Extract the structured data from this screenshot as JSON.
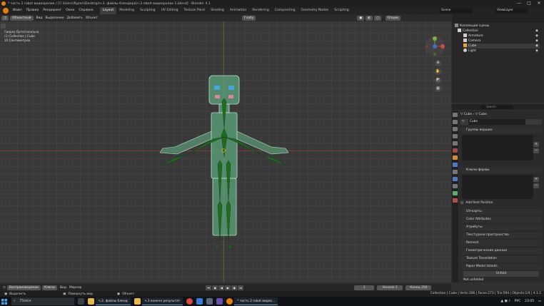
{
  "window": {
    "title": "* часть 2 robot видеоролик / [C:\\Users\\Ryzen\\Desktop\\ч.3. файлы блендера\\ч.3 robot видеоролик 1.blend] - Blender 4.1",
    "controls": [
      "—",
      "□",
      "✕"
    ]
  },
  "menu": {
    "items": [
      "Файл",
      "Правка",
      "Рендеринг",
      "Окно",
      "Справка"
    ],
    "workspaces": [
      "Layout",
      "Modeling",
      "Sculpting",
      "UV Editing",
      "Texture Paint",
      "Shading",
      "Animation",
      "Rendering",
      "Compositing",
      "Geometry Nodes",
      "Scripting"
    ],
    "active_workspace": "Layout",
    "scene": "Scene",
    "view_layer": "ViewLayer"
  },
  "viewport_header": {
    "mode": "Объектный",
    "view": "Вид",
    "select": "Выделение",
    "add": "Добавить",
    "object": "Объект",
    "orientation": "Глобу",
    "options": "Опции"
  },
  "viewport_info": {
    "line1": "Сверху Ортогонально",
    "line2": "(1) Collection | Cube",
    "line3": "10 Сантиметров"
  },
  "colors": {
    "body_fill": "#5a9c78",
    "armature": "#1f6b1f",
    "eye_blue": "#3fa8d8",
    "cheek_pink": "#d9869a",
    "accent_orange": "#e87d0d",
    "selection_outline": "#b9e0c8"
  },
  "timeline": {
    "playback": "Воспроизведение",
    "keying": "Ключи",
    "view": "Вид",
    "marker": "Маркер",
    "current_frame": "1",
    "start_label": "Начало",
    "start": "1",
    "end_label": "Конец",
    "end": "250"
  },
  "statusbar": {
    "select": "Выделить",
    "rotate": "Повернуть вид",
    "object": "Объект",
    "stats": "Collection | Cube | Verts:306 | Faces:273 | Tris:594 | Objects:1/4 | 4.1.1"
  },
  "outliner": {
    "title": "Коллекция сцены",
    "rows": [
      {
        "label": "Collection",
        "icon": "collection-icon"
      },
      {
        "label": "Armature",
        "icon": "armature-icon"
      },
      {
        "label": "Camera",
        "icon": "camera-icon"
      },
      {
        "label": "Cube",
        "icon": "mesh-icon"
      },
      {
        "label": "Light",
        "icon": "light-icon"
      }
    ]
  },
  "properties": {
    "search_placeholder": "Search",
    "breadcrumb_object": "Cube",
    "breadcrumb_data": "Cube",
    "data_name": "Cube",
    "panels": {
      "vertex_groups": "Группы вершин",
      "shape_keys": "Ключи формы",
      "add_rest_position": "Add Rest Position",
      "uv_maps": "UV-карты",
      "color_attributes": "Color Attributes",
      "attributes": "Атрибуты",
      "texture_space": "Текстурное пространство",
      "remesh": "Remesh",
      "geometry_data": "Геометрические данные",
      "texture_tessellation": "Texture Tessellation",
      "paper_model_islands": "Paper Model Islands",
      "unfold_button": "Unfold",
      "not_unfolded": "Not unfolded"
    }
  },
  "taskbar": {
    "search_placeholder": "Поиск",
    "tasks": [
      "ч.3. файлы бленд",
      "ч.3 конечн результат",
      "* часть 2 robot видео..."
    ],
    "tray_lang": "РУС",
    "tray_time": "23:05"
  }
}
